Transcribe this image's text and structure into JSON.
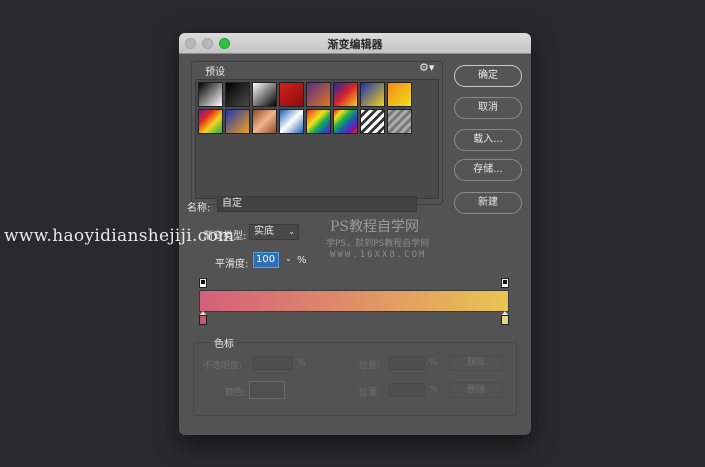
{
  "window": {
    "title": "渐变编辑器"
  },
  "presets": {
    "label": "预设",
    "gear_icon": "gear-icon",
    "swatches": [
      "linear-gradient(135deg,#000 0%,#fff 100%)",
      "linear-gradient(135deg,#000 0%,rgba(0,0,0,0) 100%)",
      "linear-gradient(135deg,#fff 0%,#000 100%)",
      "linear-gradient(135deg,#d62020 0%,#8b0c0c 100%)",
      "linear-gradient(135deg,#5a2d8a 0%,#e0761e 100%)",
      "linear-gradient(135deg,#1c2a9e 0%,#d8242a 50%,#f3d21c 100%)",
      "linear-gradient(135deg,#1a2fb4 0%,#f2d31a 100%)",
      "linear-gradient(135deg,#f3891a 0%,#f3e11a 100%)",
      "linear-gradient(135deg,#6b1cb0 0%,#e1261c 30%,#f3d21c 60%,#1cb04a 100%)",
      "linear-gradient(135deg,#1c3ab0 0%,#f3a11a 100%)",
      "linear-gradient(135deg,#8a4b2a 0%,#f0b48a 50%,#8a4b2a 100%)",
      "linear-gradient(135deg,#1c5fb0 0%,#ffffff 50%,#1c5fb0 100%)",
      "linear-gradient(135deg,#e1261c,#f3891a,#f3e11a,#1cb04a,#1c5fb0,#6b1cb0)",
      "linear-gradient(135deg,#e1261c,#f3e11a,#1cb04a,#1c5fb0,#6b1cb0,#e1261c)",
      "repeating-linear-gradient(135deg,#fff 0 3px,#333 3px 6px)",
      "repeating-linear-gradient(135deg,#aaa 0 3px,#777 3px 6px)"
    ]
  },
  "buttons": {
    "ok": "确定",
    "cancel": "取消",
    "load": "载入...",
    "save": "存储...",
    "new": "新建"
  },
  "name": {
    "label": "名称:",
    "value": "自定"
  },
  "gradient_type": {
    "label": "渐变类型:",
    "value": "实底"
  },
  "smoothness": {
    "label": "平滑度:",
    "value": "100",
    "unit": "%"
  },
  "gradient": {
    "start_color": "#d4607c",
    "end_color": "#e8c552"
  },
  "color_stops": {
    "label": "色标",
    "opacity_label": "不透明度:",
    "opacity_unit": "%",
    "location_label": "位置:",
    "location_unit": "%",
    "delete_label": "删除",
    "color_label": "颜色:",
    "location2_label": "位置:",
    "location2_unit": "%",
    "delete2_label": "删除"
  },
  "watermark": {
    "url": "www.haoyidianshejiji.com",
    "title": "PS教程自学网",
    "subtitle": "学PS，就到PS教程自学网",
    "site": "WWW.16XX8.COM"
  }
}
